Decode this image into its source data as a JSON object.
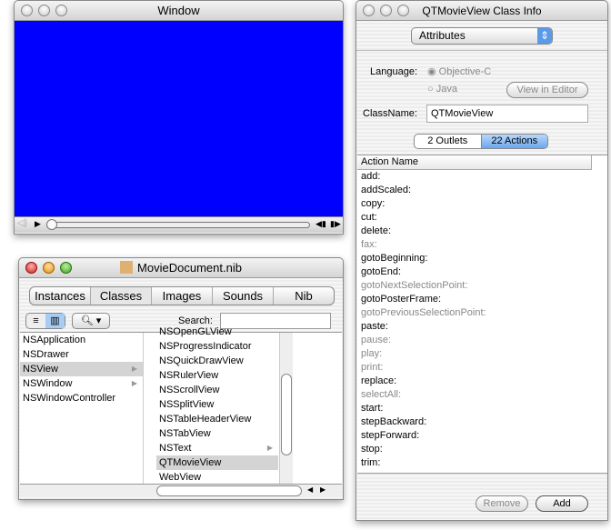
{
  "movie_window": {
    "title": "Window",
    "video_color": "#0000ff"
  },
  "nib_window": {
    "title": "MovieDocument.nib",
    "tabs": [
      "Instances",
      "Classes",
      "Images",
      "Sounds",
      "Nib"
    ],
    "search_label": "Search:",
    "search_value": "",
    "col1": [
      {
        "label": "NSApplication"
      },
      {
        "label": "NSDrawer"
      },
      {
        "label": "NSView",
        "selected": true,
        "arrow": true
      },
      {
        "label": "NSWindow",
        "arrow": true
      },
      {
        "label": "NSWindowController"
      }
    ],
    "col2": [
      {
        "label": "NSOpenGLView"
      },
      {
        "label": "NSProgressIndicator"
      },
      {
        "label": "NSQuickDrawView"
      },
      {
        "label": "NSRulerView"
      },
      {
        "label": "NSScrollView"
      },
      {
        "label": "NSSplitView"
      },
      {
        "label": "NSTableHeaderView"
      },
      {
        "label": "NSTabView"
      },
      {
        "label": "NSText",
        "arrow": true
      },
      {
        "label": "QTMovieView",
        "selected": true
      },
      {
        "label": "WebView"
      }
    ]
  },
  "info_window": {
    "title": "QTMovieView Class Info",
    "popup": "Attributes",
    "language_label": "Language:",
    "lang_options": [
      {
        "label": "Objective-C",
        "selected": true
      },
      {
        "label": "Java"
      }
    ],
    "view_in_editor": "View in Editor",
    "classname_label": "ClassName:",
    "classname_value": "QTMovieView",
    "segments": [
      "2 Outlets",
      "22 Actions"
    ],
    "column_header": "Action Name",
    "actions": [
      {
        "n": "add:"
      },
      {
        "n": "addScaled:"
      },
      {
        "n": "copy:"
      },
      {
        "n": "cut:"
      },
      {
        "n": "delete:"
      },
      {
        "n": "fax:",
        "dim": true
      },
      {
        "n": "gotoBeginning:"
      },
      {
        "n": "gotoEnd:"
      },
      {
        "n": "gotoNextSelectionPoint:",
        "dim": true
      },
      {
        "n": "gotoPosterFrame:"
      },
      {
        "n": "gotoPreviousSelectionPoint:",
        "dim": true
      },
      {
        "n": "paste:"
      },
      {
        "n": "pause:",
        "dim": true
      },
      {
        "n": "play:",
        "dim": true
      },
      {
        "n": "print:",
        "dim": true
      },
      {
        "n": "replace:"
      },
      {
        "n": "selectAll:",
        "dim": true
      },
      {
        "n": "start:"
      },
      {
        "n": "stepBackward:"
      },
      {
        "n": "stepForward:"
      },
      {
        "n": "stop:"
      },
      {
        "n": "trim:"
      }
    ],
    "remove": "Remove",
    "add": "Add"
  }
}
